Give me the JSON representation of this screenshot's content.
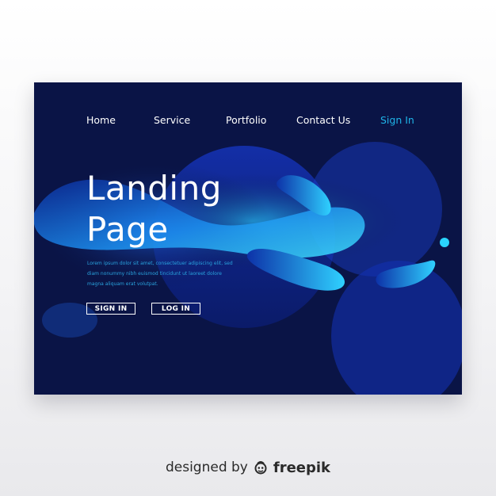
{
  "nav": {
    "items": [
      "Home",
      "Service",
      "Portfolio",
      "Contact Us"
    ],
    "signin": "Sign In"
  },
  "hero": {
    "title_line1": "Landing",
    "title_line2": "Page",
    "body": "Lorem ipsum dolor sit amet, consectetuer adipiscing elit, sed diam nonummy nibh euismod tincidunt ut laoreet dolore magna aliquam erat volutpat."
  },
  "buttons": {
    "signin": "SIGN IN",
    "login": "LOG IN"
  },
  "footer": {
    "designed": "designed by",
    "brand": "freepik",
    "logo_icon": "freepik-logo-icon"
  },
  "colors": {
    "card_bg": "#0a1446",
    "accent": "#1fb4e8",
    "body_text": "#29a3de"
  }
}
